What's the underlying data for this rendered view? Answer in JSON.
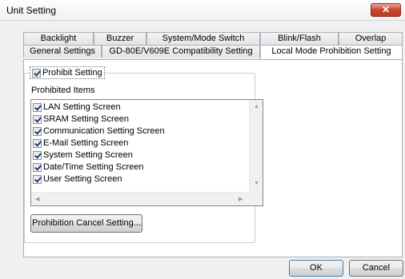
{
  "window": {
    "title": "Unit Setting",
    "close_glyph": "✕"
  },
  "tabs_row1": [
    "Backlight",
    "Buzzer",
    "System/Mode Switch",
    "Blink/Flash",
    "Overlap"
  ],
  "tabs_row2": [
    "General Settings",
    "GD-80E/V609E Compatibility Setting",
    "Local Mode Prohibition Setting"
  ],
  "active_tab": "Local Mode Prohibition Setting",
  "prohibit_setting": {
    "label": "Prohibit Setting",
    "checked": true
  },
  "prohibited_items": {
    "label": "Prohibited Items",
    "items": [
      {
        "label": "LAN Setting Screen",
        "checked": true
      },
      {
        "label": "SRAM Setting Screen",
        "checked": true
      },
      {
        "label": "Communication Setting Screen",
        "checked": true
      },
      {
        "label": "E-Mail Setting Screen",
        "checked": true
      },
      {
        "label": "System Setting Screen",
        "checked": true
      },
      {
        "label": "Date/Time Setting Screen",
        "checked": true
      },
      {
        "label": "User Setting Screen",
        "checked": true
      }
    ]
  },
  "buttons": {
    "prohibition_cancel": "Prohibition Cancel Setting...",
    "ok": "OK",
    "cancel": "Cancel"
  },
  "icons": {
    "scroll_up": "▲",
    "scroll_down": "▼",
    "scroll_left": "◀",
    "scroll_right": "▶"
  }
}
